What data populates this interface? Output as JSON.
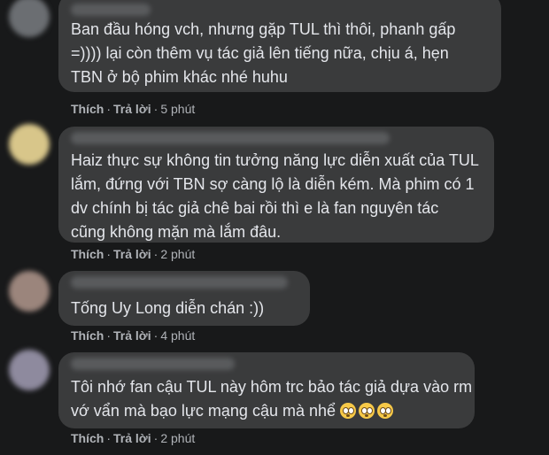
{
  "comments": [
    {
      "lines": [
        "Ban đầu hóng vch, nhưng gặp TUL thì thôi, phanh gấp",
        "=)))) lại còn thêm vụ tác giả lên tiếng nữa, chịu á, hẹn",
        "TBN ở bộ phim khác nhé huhu"
      ],
      "like": "Thích",
      "reply": "Trả lời",
      "time": "5 phút",
      "avatar_color": "#6b6e72"
    },
    {
      "lines": [
        "Haiz thực sự không tin tưởng năng lực diễn xuất của TUL",
        "lắm, đứng với TBN sợ càng lộ là diễn kém. Mà phim có 1",
        "dv chính bị tác giả chê bai rồi thì e là fan nguyên tác",
        "cũng không mặn mà lắm đâu."
      ],
      "like": "Thích",
      "reply": "Trả lời",
      "time": "2 phút",
      "avatar_color": "#d8c68a"
    },
    {
      "lines": [
        "Tống Uy Long diễn chán :))"
      ],
      "like": "Thích",
      "reply": "Trả lời",
      "time": "4 phút",
      "avatar_color": "#9b857c"
    },
    {
      "lines": [
        "Tôi nhớ fan cậu TUL này hôm trc bảo tác giả dựa vào rm",
        "vớ vẩn mà bạo lực mạng cậu mà nhể"
      ],
      "like": "Thích",
      "reply": "Trả lời",
      "time": "2 phút",
      "avatar_color": "#8e8a9e",
      "emoji_icons": [
        "flushed-face-icon",
        "flushed-face-icon",
        "flushed-face-icon"
      ]
    }
  ],
  "separator": "·"
}
